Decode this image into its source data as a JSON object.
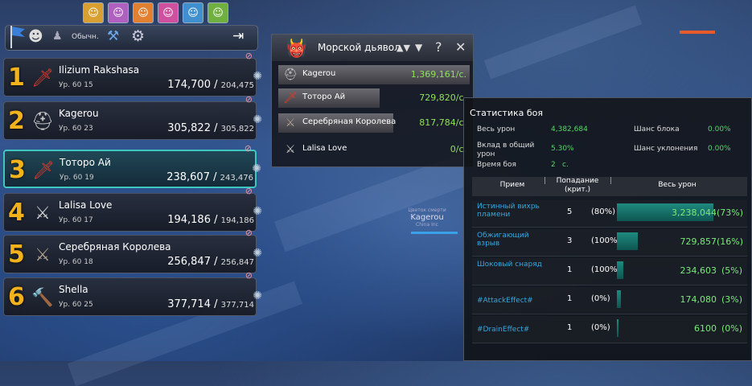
{
  "buffs": [
    {
      "icon": "buff-spiral-icon",
      "color": "#d8a030"
    },
    {
      "icon": "buff-face-purple-icon",
      "color": "#b060c0"
    },
    {
      "icon": "buff-face-orange-icon",
      "color": "#e08030"
    },
    {
      "icon": "buff-face-pink-icon",
      "color": "#d050a0"
    },
    {
      "icon": "buff-face-blue-icon",
      "color": "#4090d0"
    },
    {
      "icon": "buff-face-green-icon",
      "color": "#70b040"
    }
  ],
  "toolbar": {
    "loot_mode": "Обычн."
  },
  "party": [
    {
      "num": "1",
      "name": "Ilizium Rakshasa",
      "level": "Ур. 60",
      "sublevel": "15",
      "hp": "174,700",
      "hp_max": "204,475",
      "class_icon": "flame-sword-icon",
      "active": false
    },
    {
      "num": "2",
      "name": "Kagerou",
      "level": "Ур. 60",
      "sublevel": "23",
      "hp": "305,822",
      "hp_max": "305,822",
      "class_icon": "helmet-icon",
      "active": false
    },
    {
      "num": "3",
      "name": "Тоторо Ай",
      "level": "Ур. 60",
      "sublevel": "19",
      "hp": "238,607",
      "hp_max": "243,476",
      "class_icon": "flame-sword-icon",
      "active": true
    },
    {
      "num": "4",
      "name": "Lalisa Love",
      "level": "Ур. 60",
      "sublevel": "17",
      "hp": "194,186",
      "hp_max": "194,186",
      "class_icon": "blade-icon",
      "active": false
    },
    {
      "num": "5",
      "name": "Серебряная Королева",
      "level": "Ур. 60",
      "sublevel": "18",
      "hp": "256,847",
      "hp_max": "256,847",
      "class_icon": "crossed-axes-icon",
      "active": false
    },
    {
      "num": "6",
      "name": "Shella",
      "level": "Ур. 60",
      "sublevel": "25",
      "hp": "377,714",
      "hp_max": "377,714",
      "class_icon": "fire-hammer-icon",
      "active": false
    }
  ],
  "meter": {
    "title": "Морской дьявол",
    "rows": [
      {
        "name": "Kagerou",
        "value": "1,369,161/с.",
        "fill": 1.0,
        "icon": "helmet-icon"
      },
      {
        "name": "Тоторо Ай",
        "value": "729,820/с.",
        "fill": 0.53,
        "icon": "flame-sword-icon"
      },
      {
        "name": "Серебряная Королева",
        "value": "817,784/с.",
        "fill": 0.6,
        "icon": "crossed-axes-icon"
      },
      {
        "name": "Lalisa Love",
        "value": "0/с.",
        "fill": 0.0,
        "icon": "blade-icon"
      }
    ]
  },
  "stats": {
    "title": "Статистика боя",
    "total_label": "Весь урон",
    "total_value": "4,382,684",
    "contrib_label": "Вклад в общий урон",
    "contrib_value": "5.30%",
    "time_label": "Время боя",
    "time_value": "2",
    "time_unit": "с.",
    "block_label": "Шанс блока",
    "block_value": "0.00%",
    "evade_label": "Шанс уклонения",
    "evade_value": "0.00%",
    "col_skill": "Прием",
    "col_hits": "Попадание",
    "col_hits2": "(крит.)",
    "col_dmg": "Весь урон",
    "rows": [
      {
        "skill": "Истинный вихрь пламени",
        "hits": "5",
        "crit": "(80%)",
        "dmg": "3,238,044",
        "pct": "(73%)",
        "share": 0.73
      },
      {
        "skill": "Обжигающий взрыв",
        "hits": "3",
        "crit": "(100%)",
        "dmg": "729,857",
        "pct": "(16%)",
        "share": 0.16
      },
      {
        "skill": "Шоковый снаряд",
        "hits": "1",
        "crit": "(100%)",
        "dmg": "234,603",
        "pct": "(5%)",
        "share": 0.05
      },
      {
        "skill": "#AttackEffect#",
        "hits": "1",
        "crit": "(0%)",
        "dmg": "174,080",
        "pct": "(3%)",
        "share": 0.03
      },
      {
        "skill": "#DrainEffect#",
        "hits": "1",
        "crit": "(0%)",
        "dmg": "6100",
        "pct": "(0%)",
        "share": 0.0
      }
    ]
  },
  "nameplate": {
    "line1": "Цветок смерти",
    "name": "Kagerou",
    "line3": "China Inc"
  }
}
